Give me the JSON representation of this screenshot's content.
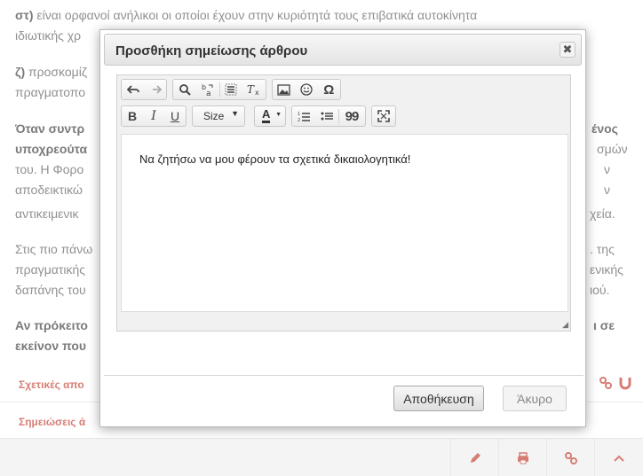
{
  "article": {
    "p1_bold": "στ)",
    "p1_text": " είναι ορφανοί ανήλικοι οι οποίοι έχουν στην κυριότητά τους επιβατικά αυτοκίνητα",
    "p1_line2": "ιδιωτικής χρ",
    "p2_bold": "ζ)",
    "p2_text": " προσκομίζ",
    "p2_line2": "πραγματοπο",
    "p3_line1": "Όταν συντρ",
    "p3_line2": "υποχρεούτα",
    "p3_line3": "του. Η Φορο",
    "p3_line4": "αποδεικτικώ",
    "p3_line5": "αντικειμενικ",
    "p3_r1": "ένος",
    "p3_r2": "σμών",
    "p3_r3": "ν",
    "p3_r4": "ν",
    "p3_r5": "χεία.",
    "p4_line1": "Στις πιο πάνω",
    "p4_line2": "πραγματικής",
    "p4_line3": "δαπάνης του",
    "p4_r1": ". της",
    "p4_r2": "ενικής",
    "p4_r3": "ιού.",
    "p5_line1": "Αν πρόκειτο",
    "p5_line2": "εκείνον που",
    "p5_r1": "ι σε",
    "related_label": "Σχετικές απο",
    "notes_label": "Σημειώσεις ά"
  },
  "footer": {
    "icons": [
      "pencil-icon",
      "printer-icon",
      "link-icon",
      "chevron-up-icon"
    ]
  },
  "dialog": {
    "title": "Προσθήκη σημείωσης άρθρου",
    "close_symbol": "✖",
    "toolbar": {
      "size_label": "Size",
      "bold": "B",
      "italic": "I",
      "underline": "U",
      "font_color": "A",
      "omega": "Ω",
      "blockquote": "99"
    },
    "content_text": "Να ζητήσω να μου φέρουν τα σχετικά δικαιολογητικά!",
    "save_label": "Αποθήκευση",
    "cancel_label": "Άκυρο"
  },
  "colors": {
    "accent": "#c0392b"
  }
}
